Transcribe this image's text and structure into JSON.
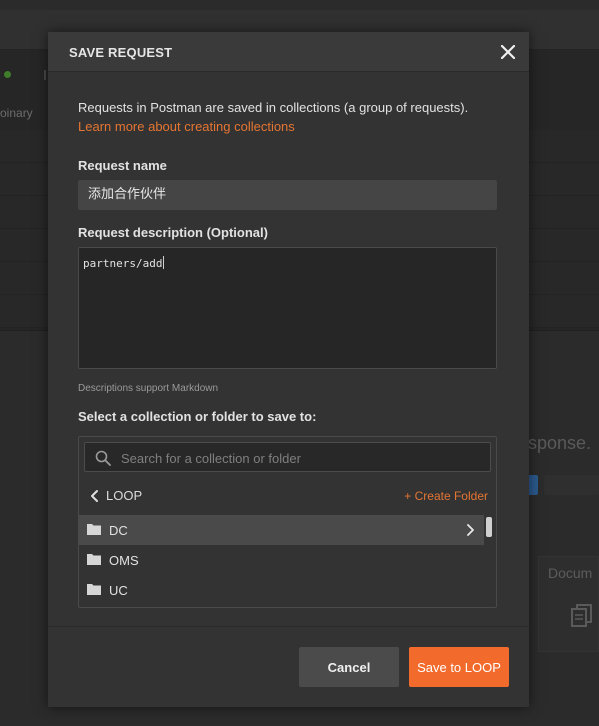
{
  "background": {
    "binary_fragment": "oinary",
    "response_fragment": "sponse.",
    "docs_fragment": "Docum"
  },
  "modal": {
    "title": "SAVE REQUEST",
    "close_icon": "close-icon",
    "intro_text": "Requests in Postman are saved in collections (a group of requests).",
    "learn_link": "Learn more about creating collections",
    "request_name_label": "Request name",
    "request_name_value": "添加合作伙伴",
    "request_description_label": "Request description (Optional)",
    "request_description_value": "partners/add",
    "markdown_note": "Descriptions support Markdown",
    "select_label": "Select a collection or folder to save to:",
    "search_placeholder": "Search for a collection or folder",
    "current_collection": "LOOP",
    "create_folder_label": "+ Create Folder",
    "folders": [
      {
        "label": "DC",
        "selected": true,
        "has_children": true
      },
      {
        "label": "OMS",
        "selected": false,
        "has_children": false
      },
      {
        "label": "UC",
        "selected": false,
        "has_children": false
      }
    ],
    "cancel_label": "Cancel",
    "save_label": "Save to LOOP"
  },
  "colors": {
    "accent": "#f26b2c",
    "link": "#e57533",
    "modal_bg": "#333333"
  }
}
